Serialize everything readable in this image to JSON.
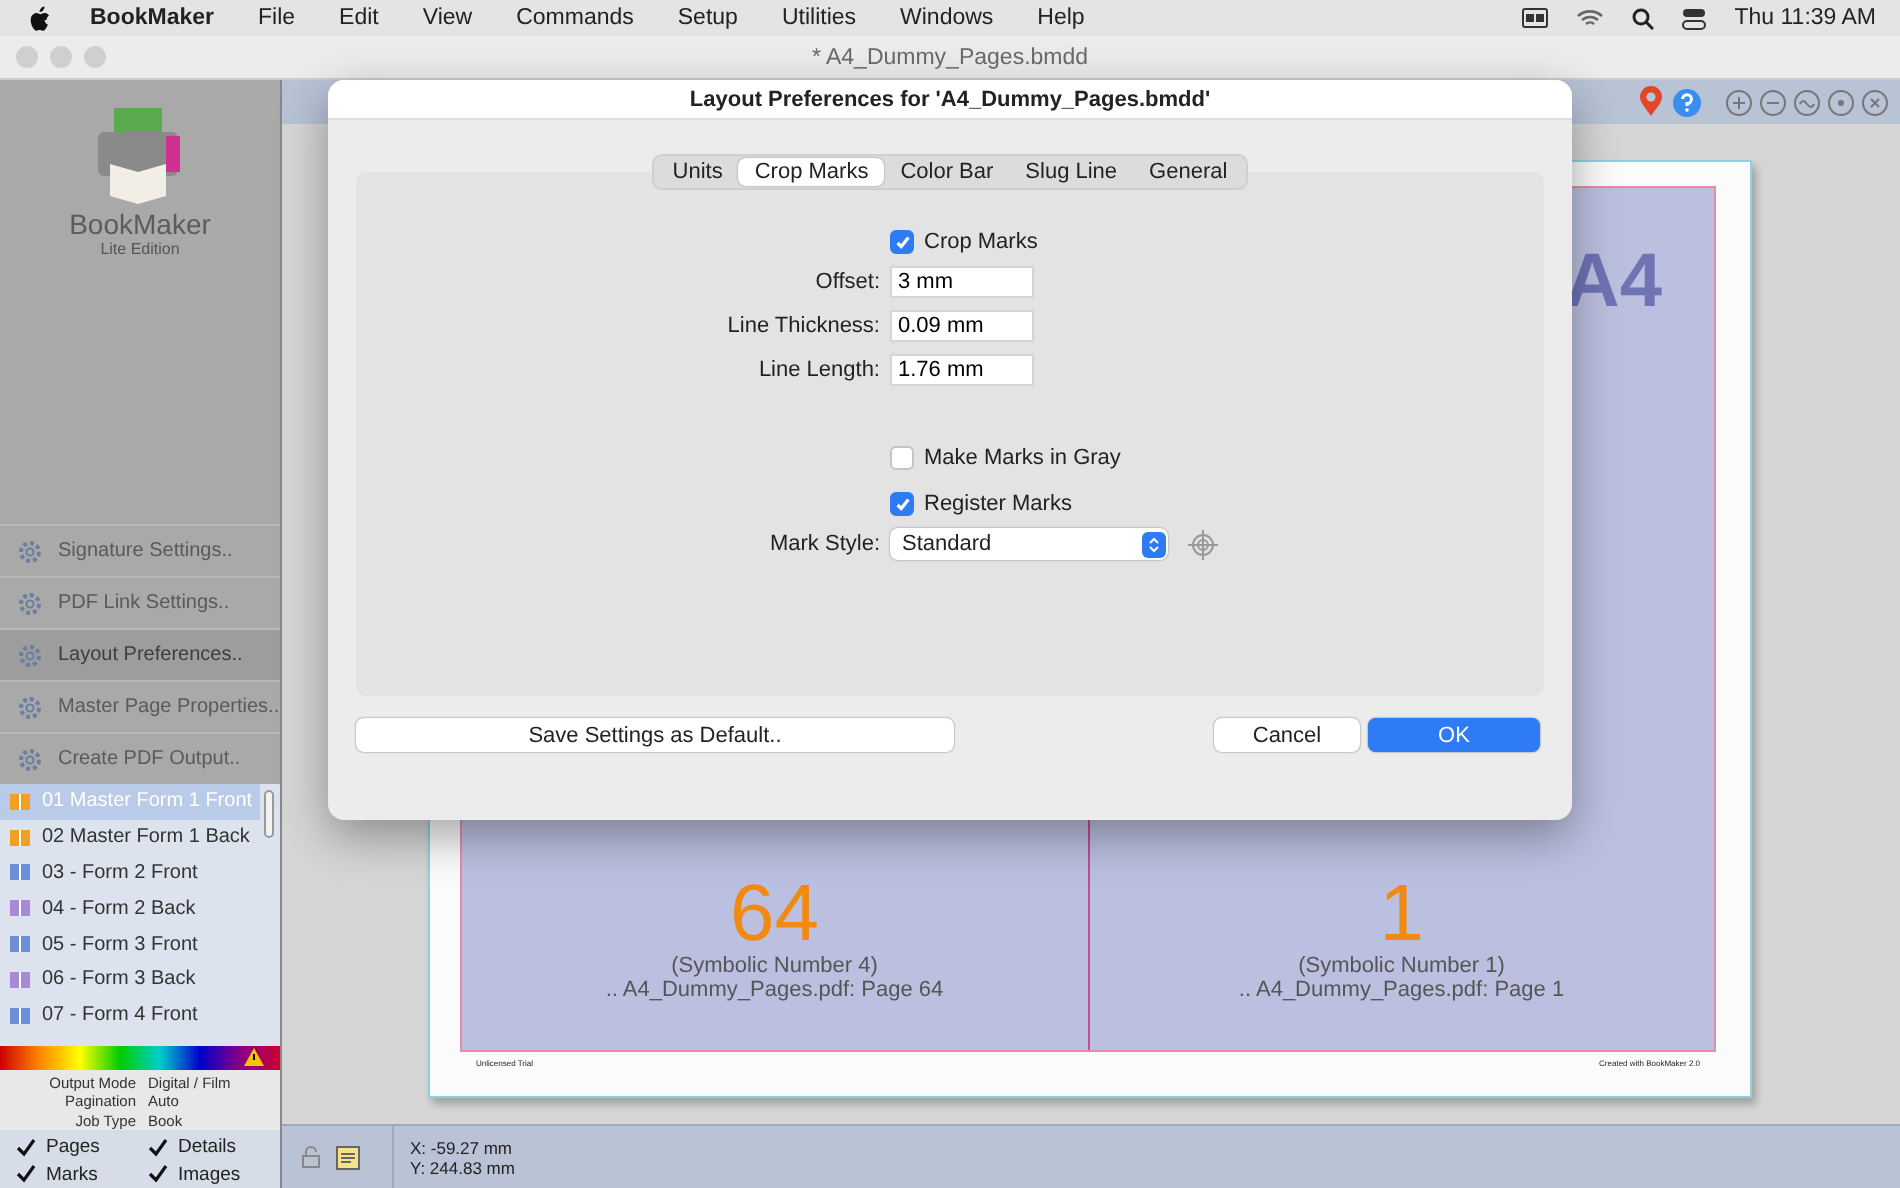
{
  "menubar": {
    "app": "BookMaker",
    "items": [
      "File",
      "Edit",
      "View",
      "Commands",
      "Setup",
      "Utilities",
      "Windows",
      "Help"
    ],
    "clock": "Thu 11:39 AM"
  },
  "window": {
    "title": "* A4_Dummy_Pages.bmdd"
  },
  "sidebar": {
    "logo_name": "BookMaker",
    "logo_edition": "Lite Edition",
    "actions": [
      {
        "label": "Signature Settings..",
        "selected": false
      },
      {
        "label": "PDF Link Settings..",
        "selected": false
      },
      {
        "label": "Layout Preferences..",
        "selected": true
      },
      {
        "label": "Master Page Properties..",
        "selected": false
      },
      {
        "label": "Create PDF Output..",
        "selected": false
      }
    ],
    "pages": [
      {
        "label": "01 Master Form 1 Front",
        "kind": "master",
        "selected": true
      },
      {
        "label": "02 Master Form 1 Back",
        "kind": "master",
        "selected": false
      },
      {
        "label": "03 - Form 2 Front",
        "kind": "front",
        "selected": false
      },
      {
        "label": "04 - Form 2 Back",
        "kind": "back",
        "selected": false
      },
      {
        "label": "05 - Form 3 Front",
        "kind": "front",
        "selected": false
      },
      {
        "label": "06 - Form 3 Back",
        "kind": "back",
        "selected": false
      },
      {
        "label": "07 - Form 4 Front",
        "kind": "front",
        "selected": false
      }
    ],
    "info": [
      {
        "label": "Output Mode",
        "value": "Digital / Film"
      },
      {
        "label": "Pagination",
        "value": "Auto"
      },
      {
        "label": "Job Type",
        "value": "Book"
      }
    ],
    "toggles": [
      {
        "label": "Pages",
        "checked": true
      },
      {
        "label": "Details",
        "checked": true
      },
      {
        "label": "Marks",
        "checked": true
      },
      {
        "label": "Images",
        "checked": true
      }
    ]
  },
  "document": {
    "corner_label": "A4",
    "panels": [
      {
        "number": "64",
        "caption": "(Symbolic Number 4)",
        "source": ".. A4_Dummy_Pages.pdf: Page 64"
      },
      {
        "number": "1",
        "caption": "(Symbolic Number 1)",
        "source": ".. A4_Dummy_Pages.pdf: Page 1"
      }
    ],
    "slug_left": "Unlicensed Trial",
    "slug_right": "Created with BookMaker 2.0"
  },
  "status": {
    "x": "X: -59.27 mm",
    "y": "Y: 244.83 mm"
  },
  "dialog": {
    "title": "Layout Preferences for 'A4_Dummy_Pages.bmdd'",
    "tabs": [
      {
        "label": "Units",
        "selected": false
      },
      {
        "label": "Crop Marks",
        "selected": true
      },
      {
        "label": "Color Bar",
        "selected": false
      },
      {
        "label": "Slug Line",
        "selected": false
      },
      {
        "label": "General",
        "selected": false
      }
    ],
    "crop_marks": {
      "label": "Crop Marks",
      "checked": true
    },
    "fields": [
      {
        "label": "Offset:",
        "value": "3 mm"
      },
      {
        "label": "Line Thickness:",
        "value": "0.09 mm"
      },
      {
        "label": "Line Length:",
        "value": "1.76 mm"
      }
    ],
    "gray_marks": {
      "label": "Make Marks in Gray",
      "checked": false
    },
    "register_marks": {
      "label": "Register Marks",
      "checked": true
    },
    "mark_style": {
      "label": "Mark Style:",
      "value": "Standard"
    },
    "save_default": "Save Settings as Default..",
    "buttons": [
      {
        "label": "Cancel",
        "kind": "normal"
      },
      {
        "label": "OK",
        "kind": "default"
      }
    ]
  }
}
